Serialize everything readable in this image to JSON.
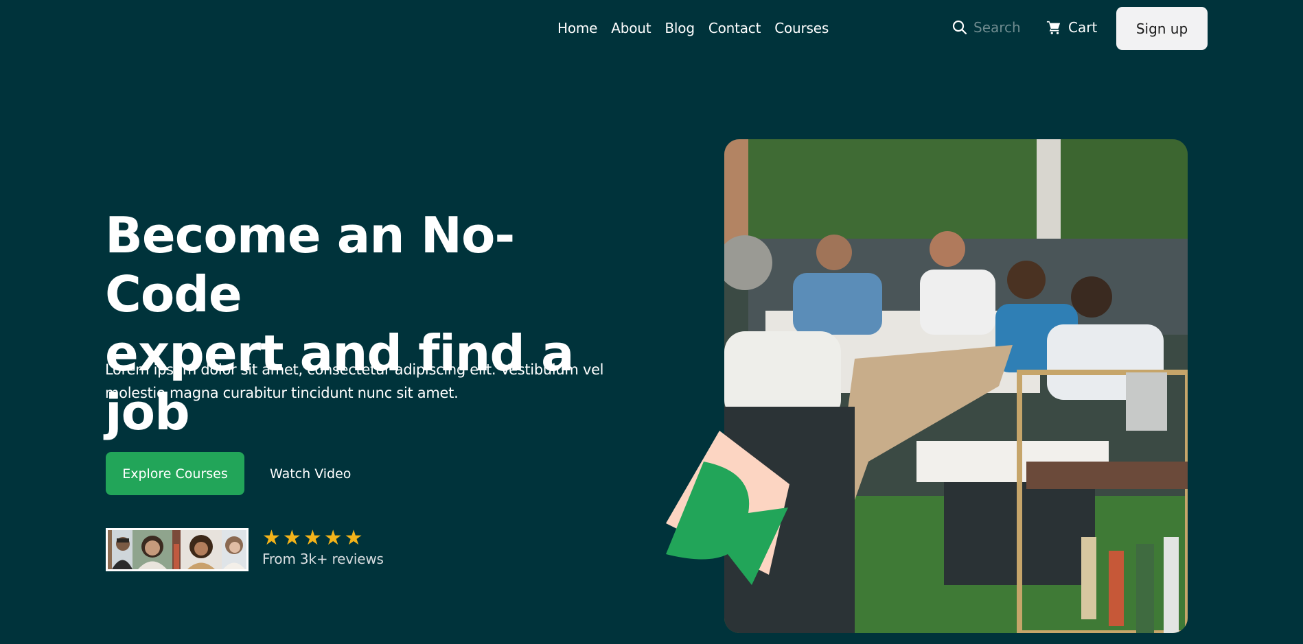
{
  "nav": {
    "links": [
      "Home",
      "About",
      "Blog",
      "Contact",
      "Courses"
    ],
    "search_placeholder": "Search",
    "cart_label": "Cart",
    "signup_label": "Sign up"
  },
  "hero": {
    "title_line1": "Become an No-Code",
    "title_line2": "expert and find a job",
    "description_line1": "Lorem ipsum dolor sit amet, consectetur adipiscing elit. Vestibulum vel",
    "description_line2": "molestie magna curabitur tincidunt nunc sit amet.",
    "explore_label": "Explore Courses",
    "watch_label": "Watch Video",
    "rating_stars": 5,
    "reviews_text": "From 3k+ reviews"
  },
  "colors": {
    "background": "#00333b",
    "accent": "#22a559",
    "star": "#f4b41a",
    "signup_bg": "#f2f2f3",
    "shape_peach": "#fcd5c2"
  },
  "icons": {
    "search": "search-icon",
    "cart": "cart-icon",
    "star": "star-icon"
  }
}
